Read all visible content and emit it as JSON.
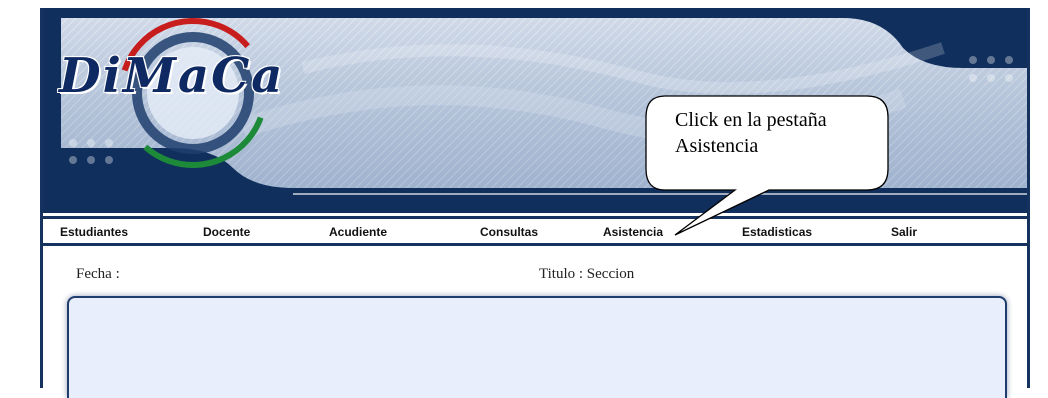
{
  "logo": {
    "text": "DiMaCa"
  },
  "nav": {
    "items": [
      {
        "label": "Estudiantes"
      },
      {
        "label": "Docente"
      },
      {
        "label": "Acudiente"
      },
      {
        "label": "Consultas"
      },
      {
        "label": "Asistencia"
      },
      {
        "label": "Estadisticas"
      },
      {
        "label": "Salir"
      }
    ]
  },
  "page": {
    "fecha_label": "Fecha :",
    "titulo_label": "Titulo : Seccion"
  },
  "callout": {
    "line1": "Click en la pestaña",
    "line2": "Asistencia"
  },
  "colors": {
    "banner_dark": "#102f5c",
    "banner_light": "#b8c7dd",
    "content_bg": "#e8eefb",
    "logo_red": "#c81d1d",
    "logo_green": "#1d8a3a"
  }
}
